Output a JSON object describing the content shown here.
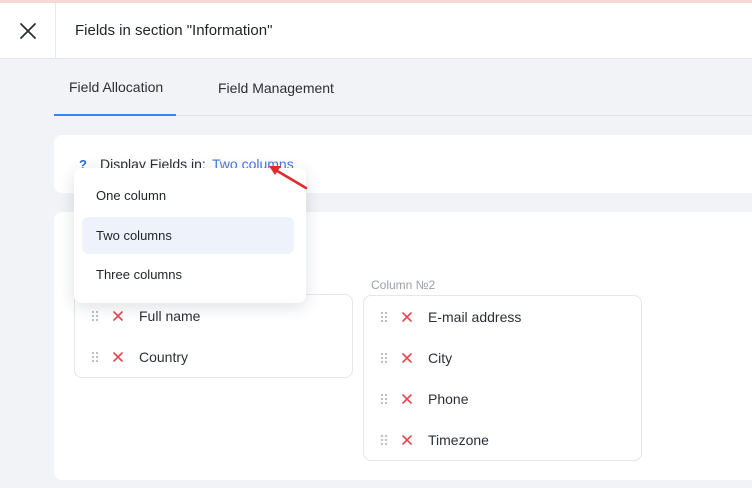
{
  "header": {
    "title": "Fields in section \"Information\""
  },
  "tabs": [
    {
      "label": "Field Allocation",
      "active": true
    },
    {
      "label": "Field Management",
      "active": false
    }
  ],
  "display": {
    "help": "?",
    "label": "Display Fields in:",
    "value": "Two columns"
  },
  "dropdown": {
    "options": [
      "One column",
      "Two columns",
      "Three columns"
    ],
    "selected": "Two columns"
  },
  "columns": [
    {
      "title": "",
      "fields": [
        "Full name",
        "Country"
      ]
    },
    {
      "title": "Column №2",
      "fields": [
        "E-mail address",
        "City",
        "Phone",
        "Timezone"
      ]
    }
  ],
  "colors": {
    "accent": "#3b82f6",
    "link": "#4776e6",
    "remove": "#e5484d",
    "arrow": "#e02b2b"
  },
  "icons": [
    "close-icon",
    "help-icon",
    "drag-handle-icon",
    "remove-icon",
    "annotation-arrow"
  ]
}
